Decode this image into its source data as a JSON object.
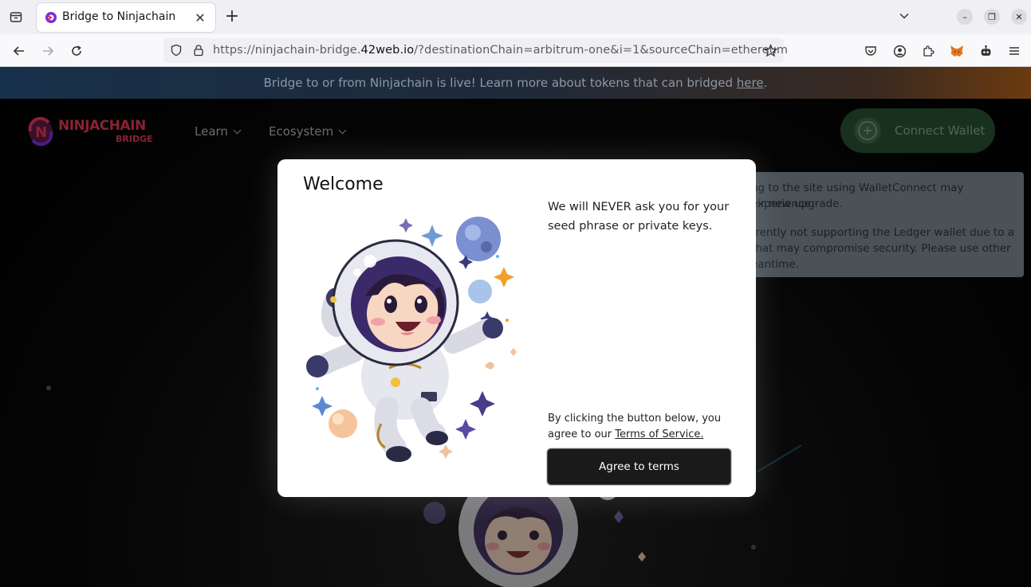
{
  "browser": {
    "tab_title": "Bridge to Ninjachain",
    "url_prefix": "https://ninjachain-bridge.",
    "url_domain": "42web.io",
    "url_suffix": "/?destinationChain=arbitrum-one&i=1&sourceChain=ethereum"
  },
  "banner": {
    "text": "Bridge to or from Ninjachain is live! Learn more about tokens that can bridged ",
    "link": "here",
    "end": "."
  },
  "header": {
    "logo_text": "NINJACHAIN",
    "logo_sub": "BRIDGE",
    "menu": [
      "Learn",
      "Ecosystem"
    ],
    "connect_label": "Connect Wallet"
  },
  "notice": {
    "line1": "ng to the site using WalletConnect may experience",
    "line2": "eir new upgrade.",
    "line3": "rrently not supporting the Ledger wallet due to a",
    "line4": "that may compromise security. Please use other",
    "line5": "eantime."
  },
  "modal": {
    "title": "Welcome",
    "warning": "We will NEVER ask you for your seed phrase or private keys.",
    "terms_prefix": "By clicking the button below, you agree to our ",
    "terms_link": "Terms of Service.",
    "agree_label": "Agree to terms"
  }
}
